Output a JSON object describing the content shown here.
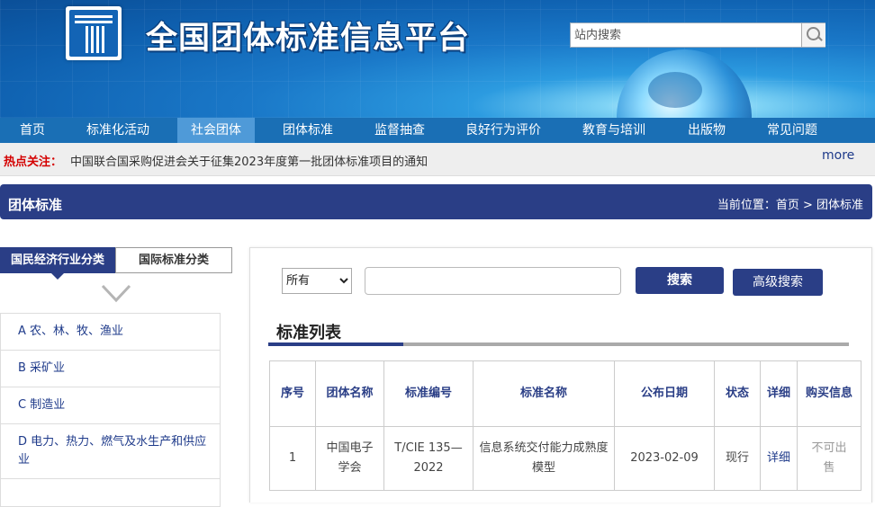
{
  "header": {
    "site_title": "全国团体标准信息平台",
    "search_placeholder": "站内搜索"
  },
  "nav": {
    "items": [
      "首页",
      "标准化活动",
      "社会团体",
      "团体标准",
      "监督抽查",
      "良好行为评价",
      "教育与培训",
      "出版物",
      "常见问题"
    ],
    "active": "社会团体"
  },
  "hotbar": {
    "label": "热点关注：",
    "text": "中国联合国采购促进会关于征集2023年度第一批团体标准项目的通知",
    "more": "more"
  },
  "section": {
    "title": "团体标准",
    "breadcrumb": "当前位置：首页 > 团体标准"
  },
  "sidebar": {
    "tab_active": "国民经济行业分类",
    "tab_other": "国际标准分类",
    "categories": [
      "A 农、林、牧、渔业",
      "B 采矿业",
      "C 制造业",
      "D 电力、热力、燃气及水生产和供应业"
    ]
  },
  "search": {
    "select_value": "所有",
    "search_label": "搜索",
    "advanced_label": "高级搜索"
  },
  "list": {
    "title": "标准列表",
    "columns": [
      "序号",
      "团体名称",
      "标准编号",
      "标准名称",
      "公布日期",
      "状态",
      "详细",
      "购买信息"
    ],
    "rows": [
      [
        "1",
        "中国电子学会",
        "T/CIE 135—2022",
        "信息系统交付能力成熟度模型",
        "2023-02-09",
        "现行",
        "详细",
        "不可出售"
      ]
    ]
  },
  "colors": {
    "brand_navy": "#2a3e86",
    "nav_blue": "#1a6fb5",
    "nav_active": "#4f9ad8",
    "hot_red": "#d40000"
  }
}
